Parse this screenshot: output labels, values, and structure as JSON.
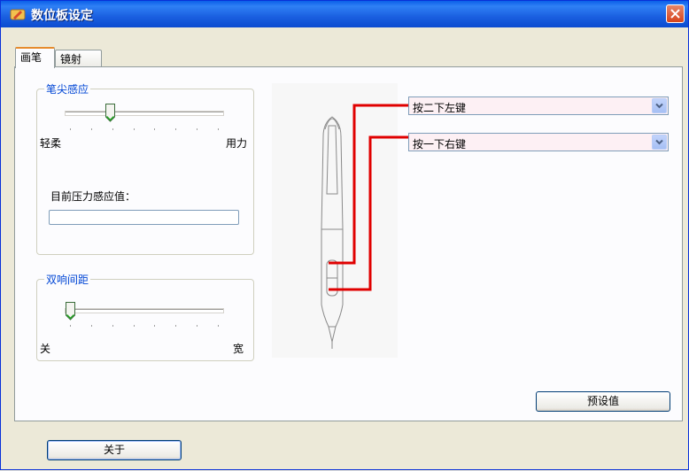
{
  "window": {
    "title": "数位板设定"
  },
  "tabs": [
    {
      "label": "画笔"
    },
    {
      "label": "镜射"
    }
  ],
  "tip_sensitivity": {
    "title": "笔尖感应",
    "min_label": "轻柔",
    "max_label": "用力",
    "value_fraction": 0.27
  },
  "pressure": {
    "label": "目前压力感应值：",
    "value_fraction": 0
  },
  "double_click": {
    "title": "双响间距",
    "min_label": "关",
    "max_label": "宽",
    "value_fraction": 0.0
  },
  "button_upper": {
    "value": "按二下左键"
  },
  "button_lower": {
    "value": "按一下右键"
  },
  "buttons": {
    "default_label": "预设值",
    "about_label": "关于"
  },
  "colors": {
    "callout_line": "#e00000",
    "group_title": "#0046d5",
    "titlebar": "#0a5fe8"
  }
}
